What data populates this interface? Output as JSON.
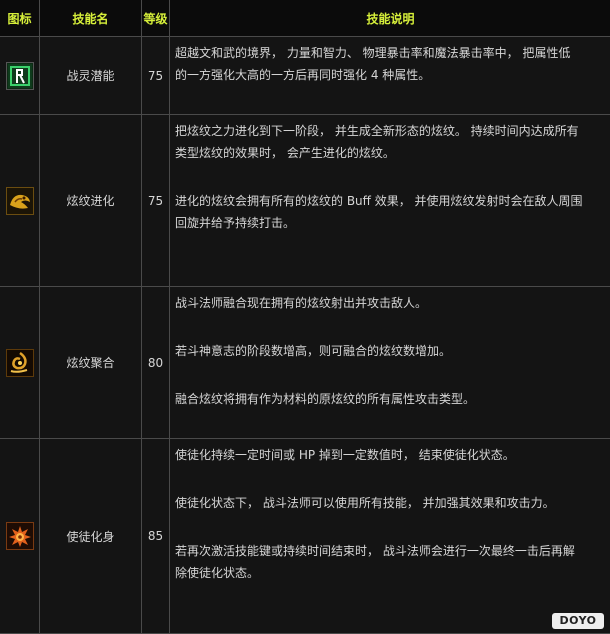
{
  "header": {
    "icon": "图标",
    "name": "技能名",
    "level": "等级",
    "desc": "技能说明"
  },
  "skills": [
    {
      "icon": "spirit-figure-icon",
      "name": "战灵潜能",
      "level": "75",
      "desc": [
        "超越文和武的境界， 力量和智力、 物理暴击率和魔法暴击率中， 把属性低",
        "的一方强化大高的一方后再同时强化 4 种属性。"
      ]
    },
    {
      "icon": "dragon-crest-icon",
      "name": "炫纹进化",
      "level": "75",
      "desc": [
        "把炫纹之力进化到下一阶段， 并生成全新形态的炫纹。 持续时间内达成所有",
        "类型炫纹的效果时， 会产生进化的炫纹。",
        "进化的炫纹会拥有所有的炫纹的 Buff 效果， 并使用炫纹发射时会在敌人周围",
        "回旋并给予持续打击。"
      ]
    },
    {
      "icon": "crest-fusion-icon",
      "name": "炫纹聚合",
      "level": "80",
      "desc": [
        "战斗法师融合现在拥有的炫纹射出并攻击敌人。",
        "若斗神意志的阶段数增高，则可融合的炫纹数增加。",
        "融合炫纹将拥有作为材料的原炫纹的所有属性攻击类型。"
      ]
    },
    {
      "icon": "apostle-flame-icon",
      "name": "使徒化身",
      "level": "85",
      "desc": [
        "使徒化持续一定时间或 HP 掉到一定数值时， 结束使徒化状态。",
        "使徒化状态下， 战斗法师可以使用所有技能， 并加强其效果和攻击力。",
        "若再次激活技能键或持续时间结束时， 战斗法师会进行一次最终一击后再解",
        "除使徒化状态。"
      ]
    }
  ],
  "watermark": "DOYO"
}
